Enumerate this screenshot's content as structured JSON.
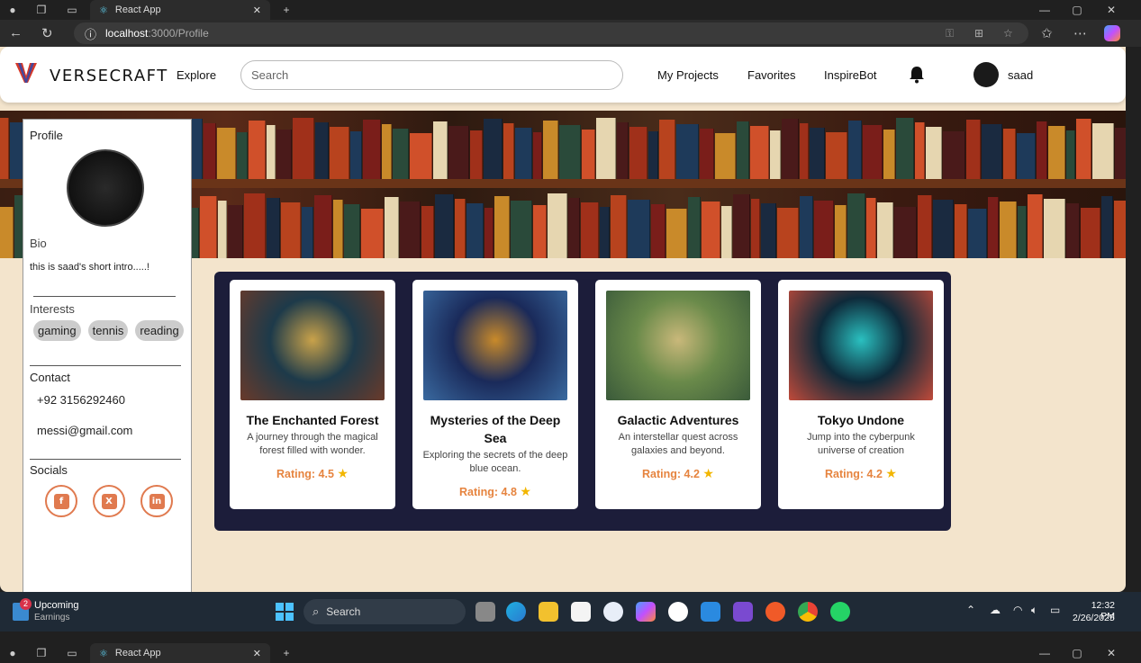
{
  "browser": {
    "tab_title": "React App",
    "url_host": "localhost",
    "url_path": ":3000/Profile",
    "new_tab": "+",
    "min": "—",
    "max": "▢",
    "close": "✕"
  },
  "navbar": {
    "brand": "VERSECRAFT",
    "explore": "Explore",
    "search_placeholder": "Search",
    "links": [
      "My Projects",
      "Favorites",
      "InspireBot"
    ],
    "username": "saad"
  },
  "sidebar": {
    "profile_title": "Profile",
    "bio_title": "Bio",
    "bio_text": "this is saad's short intro.....!",
    "interests_title": "Interests",
    "interests": [
      "gaming",
      "tennis",
      "reading"
    ],
    "contact_title": "Contact",
    "phone": "+92 3156292460",
    "email": "messi@gmail.com",
    "socials_title": "Socials",
    "socials": [
      {
        "name": "facebook-icon",
        "glyph": "f"
      },
      {
        "name": "x-icon",
        "glyph": "X"
      },
      {
        "name": "linkedin-icon",
        "glyph": "in"
      }
    ]
  },
  "cards": [
    {
      "title": "The Enchanted Forest",
      "desc": "A journey through the magical forest filled with wonder.",
      "rating": "Rating: 4.5",
      "colors": [
        "#1d3a4a",
        "#c9a24a",
        "#6a3a2a"
      ]
    },
    {
      "title": "Mysteries of the Deep Sea",
      "desc": "Exploring the secrets of the deep blue ocean.",
      "rating": "Rating: 4.8",
      "colors": [
        "#1a2a5a",
        "#c98a2a",
        "#3a6aa0"
      ]
    },
    {
      "title": "Galactic Adventures",
      "desc": "An interstellar quest across galaxies and beyond.",
      "rating": "Rating: 4.2",
      "colors": [
        "#6a8a4a",
        "#c9b87a",
        "#3a5a3a"
      ]
    },
    {
      "title": "Tokyo Undone",
      "desc": "Jump into the cyberpunk universe of creation",
      "rating": "Rating: 4.2",
      "colors": [
        "#0e2a3a",
        "#2ac0c0",
        "#c04a3a"
      ]
    }
  ],
  "taskbar": {
    "widget_title": "Upcoming",
    "widget_sub": "Earnings",
    "widget_badge": "2",
    "search": "Search",
    "time": "12:32 PM",
    "date": "2/26/2025"
  }
}
